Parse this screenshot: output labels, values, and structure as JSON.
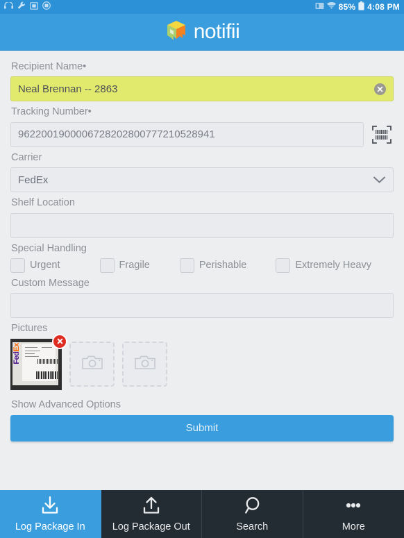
{
  "statusbar": {
    "icons_left": [
      "headset-icon",
      "wrench-icon",
      "sd-card-icon",
      "app-badge-icon"
    ],
    "icons_right": [
      "sim-icon",
      "wifi-icon",
      "battery-icon"
    ],
    "battery_percent": "85%",
    "time": "4:08 PM"
  },
  "header": {
    "logo_text": "notifii",
    "logo_icon": "notifii-box-logo",
    "bg_color": "#3a9ede"
  },
  "form": {
    "recipient": {
      "label": "Recipient Name",
      "required_mark": "•",
      "value": "Neal Brennan -- 2863",
      "placeholder": "Recipient Name",
      "clear_icon": "clear-circle-icon",
      "highlight_color": "#e2ea6e"
    },
    "tracking": {
      "label": "Tracking Number",
      "required_mark": "•",
      "value": "9622001900006728202800777210528941",
      "placeholder": "Tracking Number",
      "scan_icon": "barcode-scan-icon"
    },
    "carrier": {
      "label": "Carrier",
      "value": "FedEx",
      "chevron_icon": "chevron-down-icon"
    },
    "shelf": {
      "label": "Shelf Location",
      "value": "",
      "placeholder": ""
    },
    "special_handling": {
      "label": "Special Handling",
      "options": [
        {
          "label": "Urgent",
          "checked": false
        },
        {
          "label": "Fragile",
          "checked": false
        },
        {
          "label": "Perishable",
          "checked": false
        },
        {
          "label": "Extremely Heavy",
          "checked": false
        }
      ]
    },
    "custom_message": {
      "label": "Custom Message",
      "value": "",
      "placeholder": ""
    },
    "pictures": {
      "label": "Pictures",
      "thumbnail_alt": "fedex-shipping-label-photo",
      "delete_icon": "delete-circle-icon",
      "placeholder_icon": "camera-icon",
      "placeholder_count": 2
    },
    "advanced_label": "Show Advanced Options",
    "submit_label": "Submit",
    "submit_color": "#3a9ede"
  },
  "tabbar": {
    "items": [
      {
        "label": "Log Package In",
        "icon": "download-tray-icon",
        "active": true
      },
      {
        "label": "Log Package Out",
        "icon": "upload-tray-icon",
        "active": false
      },
      {
        "label": "Search",
        "icon": "search-icon",
        "active": false
      },
      {
        "label": "More",
        "icon": "ellipsis-icon",
        "active": false
      }
    ],
    "active_color": "#3a9ede",
    "bg_color": "#232b33"
  }
}
